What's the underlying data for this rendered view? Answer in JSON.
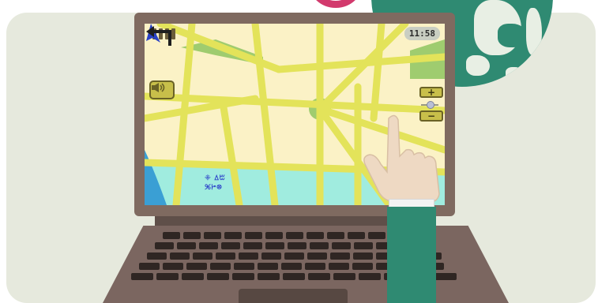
{
  "status_bar": {
    "clock": "11:58",
    "battery_bars": 4
  },
  "map": {
    "label_line1": "ꔰ ꕔꔱ",
    "label_line2": "ꕑꔵꕕ"
  },
  "controls": {
    "zoom_in_label": "+",
    "zoom_out_label": "−",
    "zoom_level": 0.6
  },
  "icons": {
    "sound": "speaker-icon",
    "battery": "signal-bars-icon",
    "navigation": "navigation-arrow-icon",
    "turn": "turn-left-arrow-icon"
  },
  "colors": {
    "lid": "#7f6a60",
    "screen_bg": "#fbf2c6",
    "road": "#e3e35a",
    "park": "#9fcc6f",
    "water": "#a0ecdf",
    "sleeve": "#2f8a72",
    "pink_accent": "#d23a6d"
  }
}
